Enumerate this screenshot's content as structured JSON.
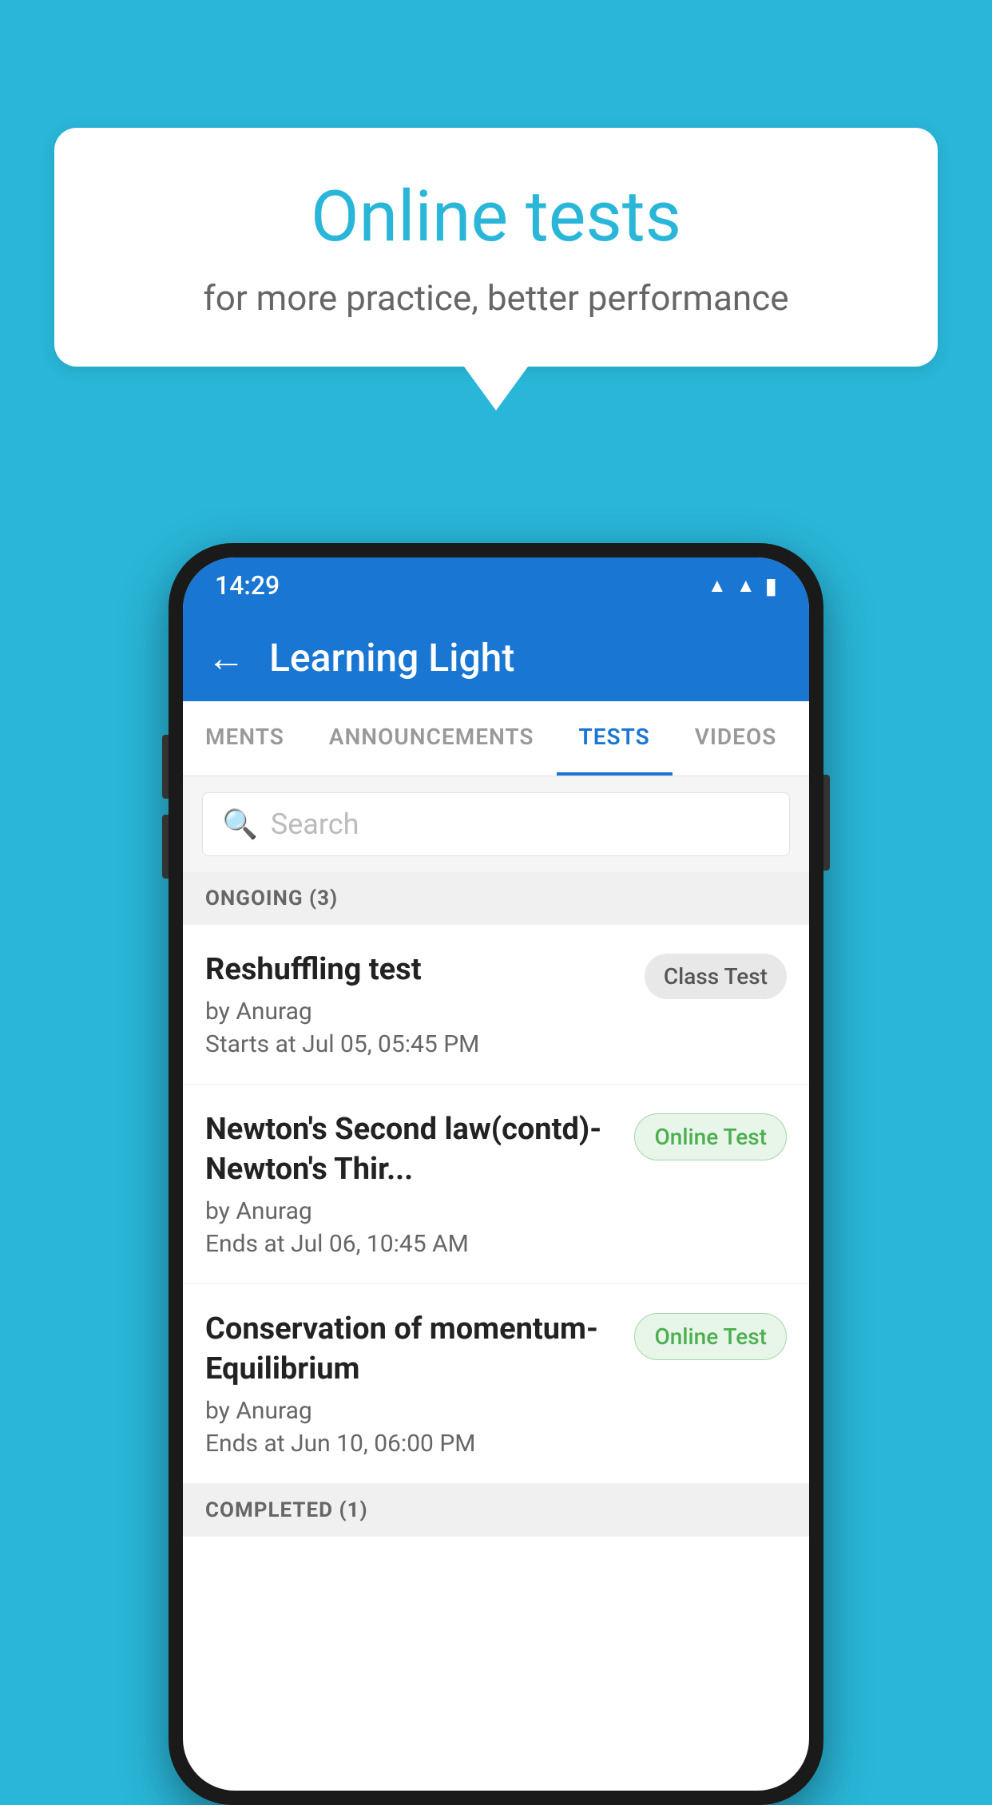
{
  "background_color": "#29b6d8",
  "speech_bubble": {
    "title": "Online tests",
    "subtitle": "for more practice, better performance"
  },
  "phone": {
    "status_bar": {
      "time": "14:29",
      "icons": [
        "wifi",
        "signal",
        "battery"
      ]
    },
    "app_bar": {
      "back_icon": "←",
      "title": "Learning Light"
    },
    "tabs": [
      {
        "label": "MENTS",
        "active": false
      },
      {
        "label": "ANNOUNCEMENTS",
        "active": false
      },
      {
        "label": "TESTS",
        "active": true
      },
      {
        "label": "VIDEOS",
        "active": false
      }
    ],
    "search": {
      "placeholder": "Search",
      "icon": "🔍"
    },
    "sections": [
      {
        "header": "ONGOING (3)",
        "tests": [
          {
            "name": "Reshuffling test",
            "author": "by Anurag",
            "date": "Starts at  Jul 05, 05:45 PM",
            "badge": "Class Test",
            "badge_type": "class"
          },
          {
            "name": "Newton's Second law(contd)-Newton's Thir...",
            "author": "by Anurag",
            "date": "Ends at  Jul 06, 10:45 AM",
            "badge": "Online Test",
            "badge_type": "online"
          },
          {
            "name": "Conservation of momentum-Equilibrium",
            "author": "by Anurag",
            "date": "Ends at  Jun 10, 06:00 PM",
            "badge": "Online Test",
            "badge_type": "online"
          }
        ]
      },
      {
        "header": "COMPLETED (1)"
      }
    ]
  }
}
